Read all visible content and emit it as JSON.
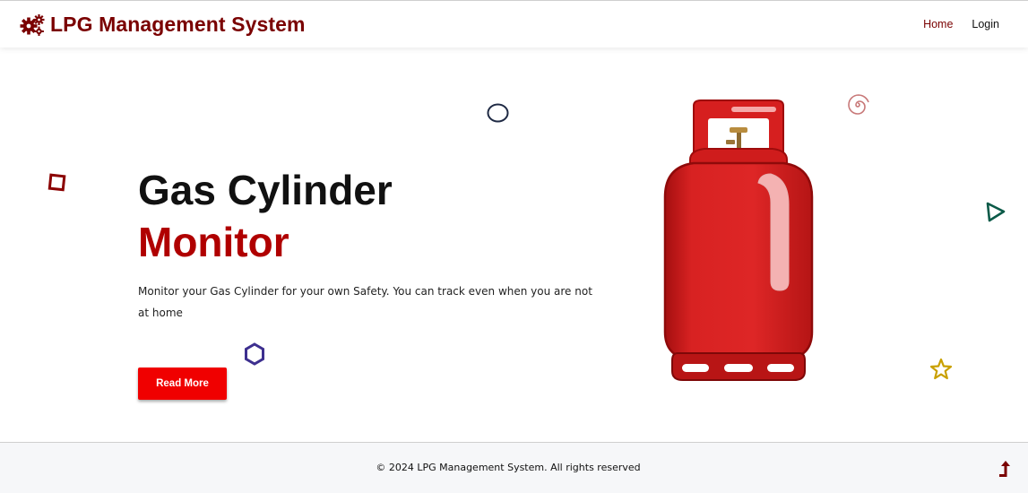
{
  "brand": {
    "title": "LPG Management System",
    "icon": "cogs-icon",
    "color": "#7a0000"
  },
  "nav": {
    "items": [
      {
        "label": "Home",
        "active": true
      },
      {
        "label": "Login",
        "active": false
      }
    ]
  },
  "hero": {
    "title_line1": "Gas Cylinder",
    "title_line2": "Monitor",
    "description": "Monitor your Gas Cylinder for your own Safety. You can track even when you are not at home",
    "button_label": "Read More",
    "accent_color": "#b00000",
    "button_color": "#f00000"
  },
  "illustration": {
    "name": "gas-cylinder-icon",
    "color": "#d62020"
  },
  "decorations": [
    {
      "name": "square-shape-icon",
      "color": "#8b0000"
    },
    {
      "name": "circle-shape-icon",
      "color": "#1f2a44"
    },
    {
      "name": "hexagon-shape-icon",
      "color": "#3d2f8f"
    },
    {
      "name": "spiral-shape-icon",
      "color": "#c87878"
    },
    {
      "name": "triangle-shape-icon",
      "color": "#0b5a48"
    },
    {
      "name": "star-shape-icon",
      "color": "#c9a000"
    }
  ],
  "footer": {
    "text": "© 2024 LPG Management System. All rights reserved",
    "scroll_top_icon": "arrow-up-icon"
  }
}
